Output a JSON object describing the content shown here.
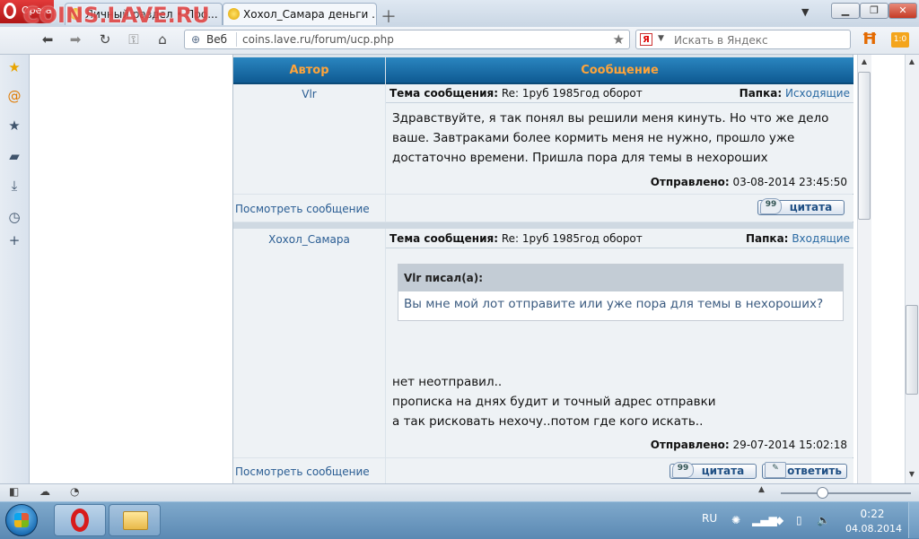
{
  "browser": {
    "menu_label": "Opera",
    "watermark": "COINS.LAVE.RU",
    "tabs": [
      {
        "label": "Личный раздел • Про..."
      },
      {
        "label": "Хохол_Самара деньги ..."
      }
    ],
    "address": {
      "web_label": "Веб",
      "url": "coins.lave.ru/forum/ucp.php"
    },
    "search": {
      "placeholder": "Искать в Яндекс",
      "engine_badge": "Я"
    },
    "ext_badge": "1:0"
  },
  "forum": {
    "header": {
      "author": "Автор",
      "message": "Сообщение"
    },
    "subject_label": "Тема сообщения:",
    "folder_label": "Папка:",
    "sent_label": "Отправлено:",
    "view_link": "Посмотреть сообщение",
    "quote_button": "цитата",
    "reply_button": "ответить",
    "posts": [
      {
        "author": "Vlr",
        "subject": "Re: 1руб 1985год оборот",
        "folder": "Исходящие",
        "lines": [
          "Здравствуйте, я так понял вы решили меня кинуть. Но что же дело",
          "ваше. Завтраками более кормить меня не нужно, прошло уже",
          "достаточно времени. Пришла пора для темы в нехороших"
        ],
        "sent": "03-08-2014 23:45:50"
      },
      {
        "author": "Хохол_Самара",
        "subject": "Re: 1руб 1985год оборот",
        "folder": "Входящие",
        "quote_head": "Vlr писал(а):",
        "quote_text": "Вы мне мой лот отправите или уже пора для темы в нехороших?",
        "lines": [
          "нет неотправил..",
          "прописка на днях будит и точный адрес отправки",
          "а так рисковать нехочу..потом где кого искать.."
        ],
        "sent": "29-07-2014 15:02:18"
      }
    ]
  },
  "taskbar": {
    "lang": "RU",
    "time": "0:22",
    "date": "04.08.2014"
  }
}
